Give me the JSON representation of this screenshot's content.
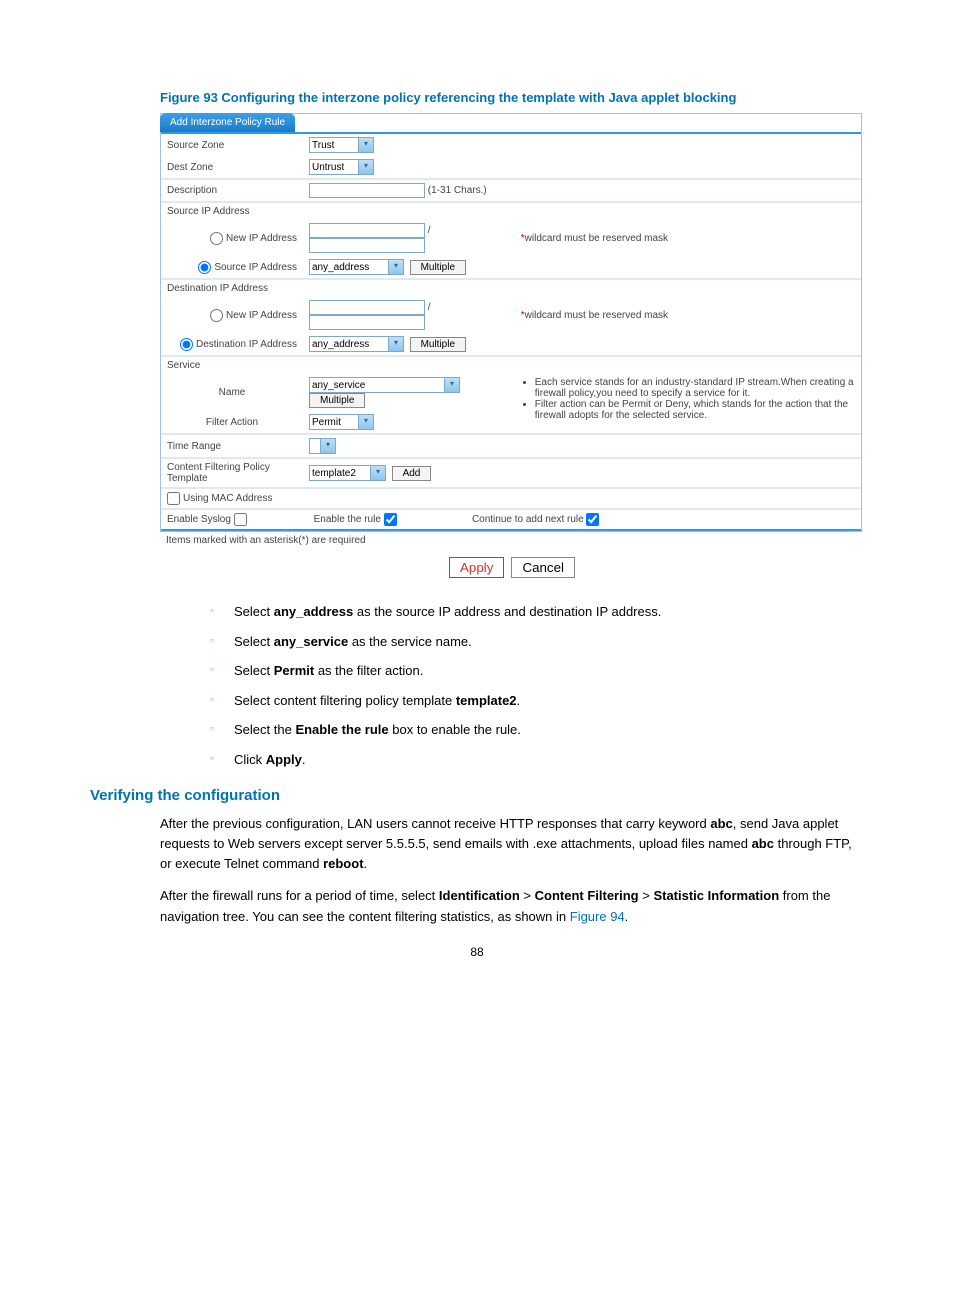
{
  "caption": "Figure 93 Configuring the interzone policy referencing the template with Java applet blocking",
  "tab": "Add Interzone Policy Rule",
  "labels": {
    "sourceZone": "Source Zone",
    "destZone": "Dest Zone",
    "description": "Description",
    "descHint": "(1-31 Chars.)",
    "sourceIPHeader": "Source IP Address",
    "newIP": "New IP Address",
    "wildcard": "wildcard must be reserved mask",
    "sourceIPAddr": "Source IP Address",
    "destIPHeader": "Destination IP Address",
    "destIPAddr": "Destination IP Address",
    "service": "Service",
    "name": "Name",
    "filterAction": "Filter Action",
    "timeRange": "Time Range",
    "contentFilter": "Content Filtering Policy Template",
    "usingMAC": "Using MAC Address",
    "enableSyslog": "Enable Syslog",
    "enableRule": "Enable the rule",
    "continueAdd": "Continue to add next rule",
    "requiredNote": "Items marked with an asterisk(*) are required",
    "multiple": "Multiple",
    "add": "Add",
    "apply": "Apply",
    "cancel": "Cancel",
    "slash": "/"
  },
  "values": {
    "sourceZone": "Trust",
    "destZone": "Untrust",
    "anyAddress": "any_address",
    "anyService": "any_service",
    "permit": "Permit",
    "template": "template2",
    "enableRuleChecked": true,
    "continueAddChecked": true
  },
  "tips": [
    "Each service stands for an industry-standard IP stream.When creating a firewall policy,you need to specify a service for it.",
    "Filter action can be Permit or Deny, which stands for the action that the firewall adopts for the selected service."
  ],
  "instructions": [
    {
      "pre": "Select ",
      "bold": "any_address",
      "post": " as the source IP address and destination IP address."
    },
    {
      "pre": "Select ",
      "bold": "any_service",
      "post": " as the service name."
    },
    {
      "pre": "Select ",
      "bold": "Permit",
      "post": " as the filter action."
    },
    {
      "pre": "Select content filtering policy template ",
      "bold": "template2",
      "post": "."
    },
    {
      "pre": "Select the ",
      "bold": "Enable the rule",
      "post": " box to enable the rule."
    },
    {
      "pre": "Click ",
      "bold": "Apply",
      "post": "."
    }
  ],
  "verify": {
    "heading": "Verifying the configuration",
    "para1_a": "After the previous configuration, LAN users cannot receive HTTP responses that carry keyword ",
    "para1_b1": "abc",
    "para1_c": ", send Java applet requests to Web servers except server 5.5.5.5, send emails with .exe attachments, upload files named ",
    "para1_b2": "abc",
    "para1_d": " through FTP, or execute Telnet command ",
    "para1_b3": "reboot",
    "para1_e": ".",
    "para2_a": "After the firewall runs for a period of time, select ",
    "para2_b1": "Identification",
    "para2_gt": " > ",
    "para2_b2": "Content Filtering",
    "para2_b3": "Statistic Information",
    "para2_c": " from the navigation tree. You can see the content filtering statistics, as shown in ",
    "para2_link": "Figure 94",
    "para2_d": "."
  },
  "pageNum": "88"
}
